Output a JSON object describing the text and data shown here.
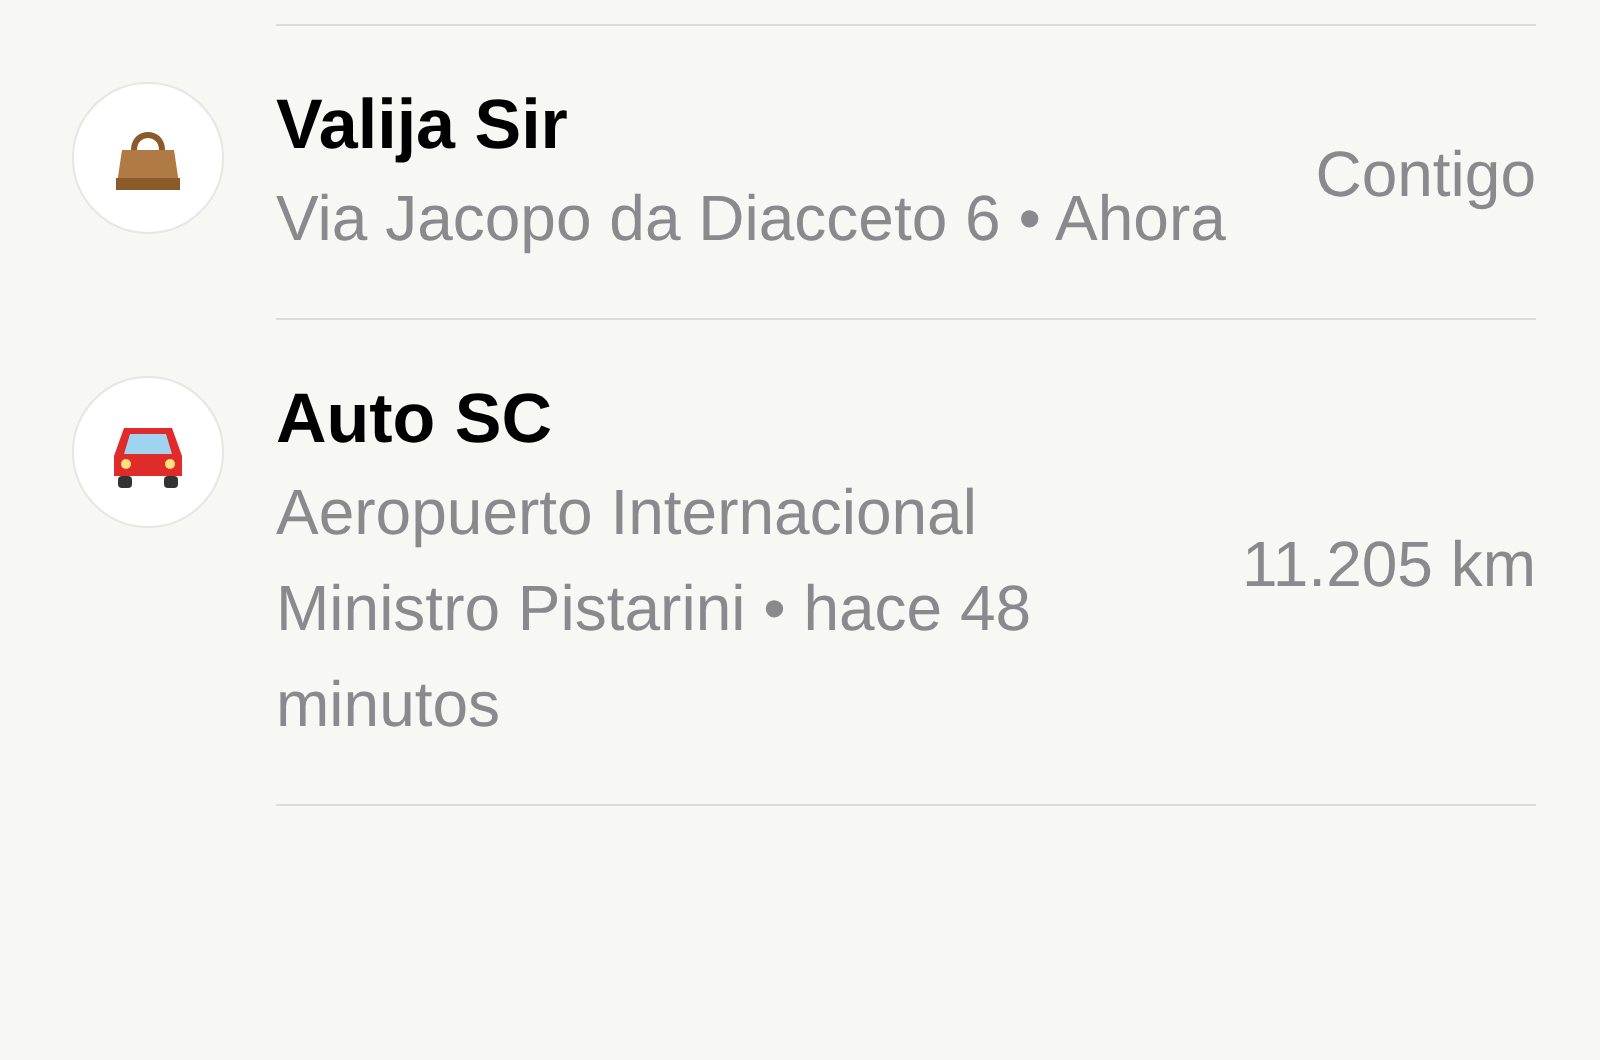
{
  "items": [
    {
      "kind": "bag",
      "name": "Valija Sir",
      "detail": "Via Jacopo da Diacceto 6 • Ahora",
      "distance": "Contigo"
    },
    {
      "kind": "car",
      "name": "Auto SC",
      "detail": "Aeropuerto Internacional Ministro Pistarini • hace 48 minutos",
      "distance": "11.205 km"
    }
  ]
}
